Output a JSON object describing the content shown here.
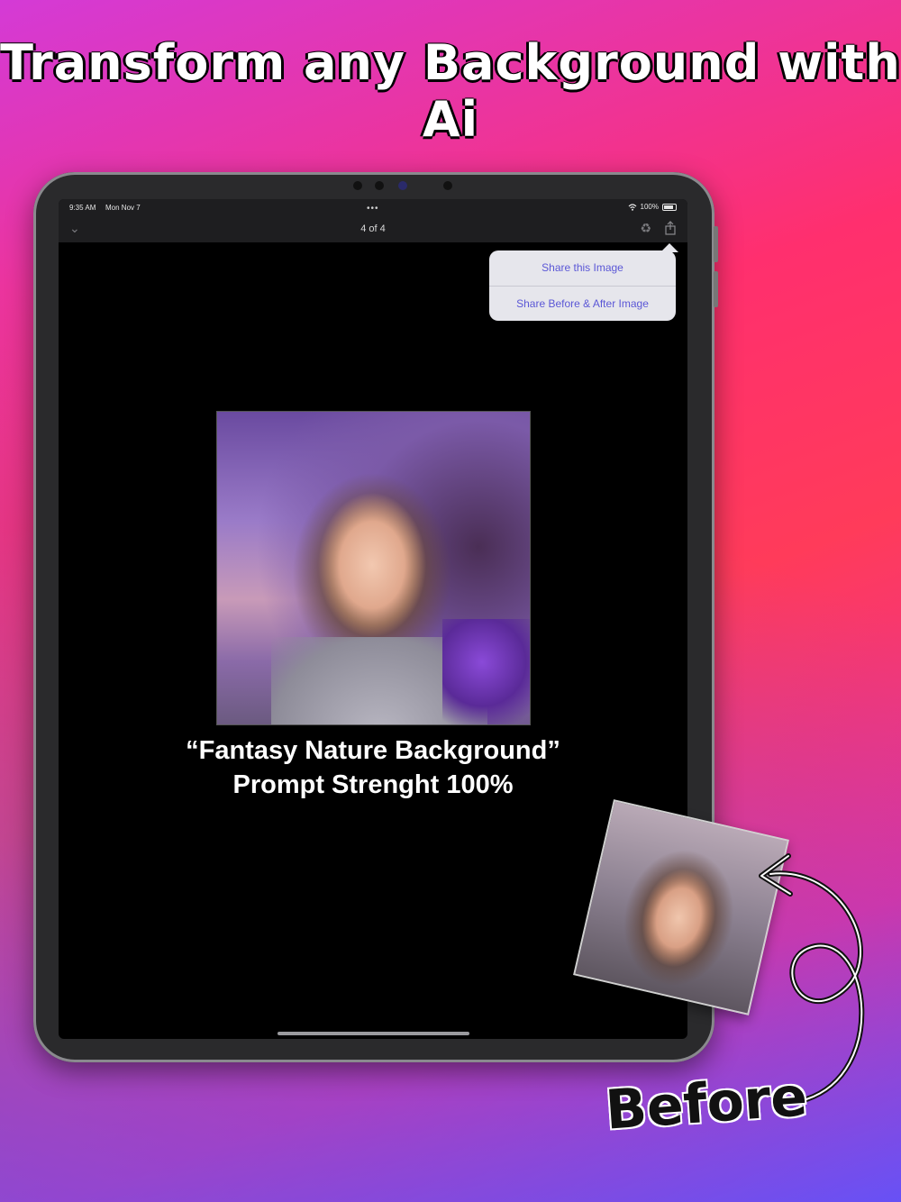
{
  "headline": "Transform any Background with Ai",
  "statusbar": {
    "time": "9:35 AM",
    "date": "Mon Nov 7",
    "battery": "100%"
  },
  "navbar": {
    "title": "4 of 4"
  },
  "share_menu": {
    "items": [
      {
        "label": "Share this Image"
      },
      {
        "label": "Share Before & After Image"
      }
    ]
  },
  "caption": {
    "line1": "“Fantasy Nature Background”",
    "line2": "Prompt Strenght 100%"
  },
  "before_label": "Before",
  "icons": {
    "chevron": "chevron-down-icon",
    "recycle": "recycle-icon",
    "share": "share-icon",
    "wifi": "wifi-icon",
    "battery": "battery-icon"
  },
  "colors": {
    "accent_menu_text": "#5b57d6",
    "menu_background": "#e6e6ec",
    "screen_background": "#000000"
  }
}
